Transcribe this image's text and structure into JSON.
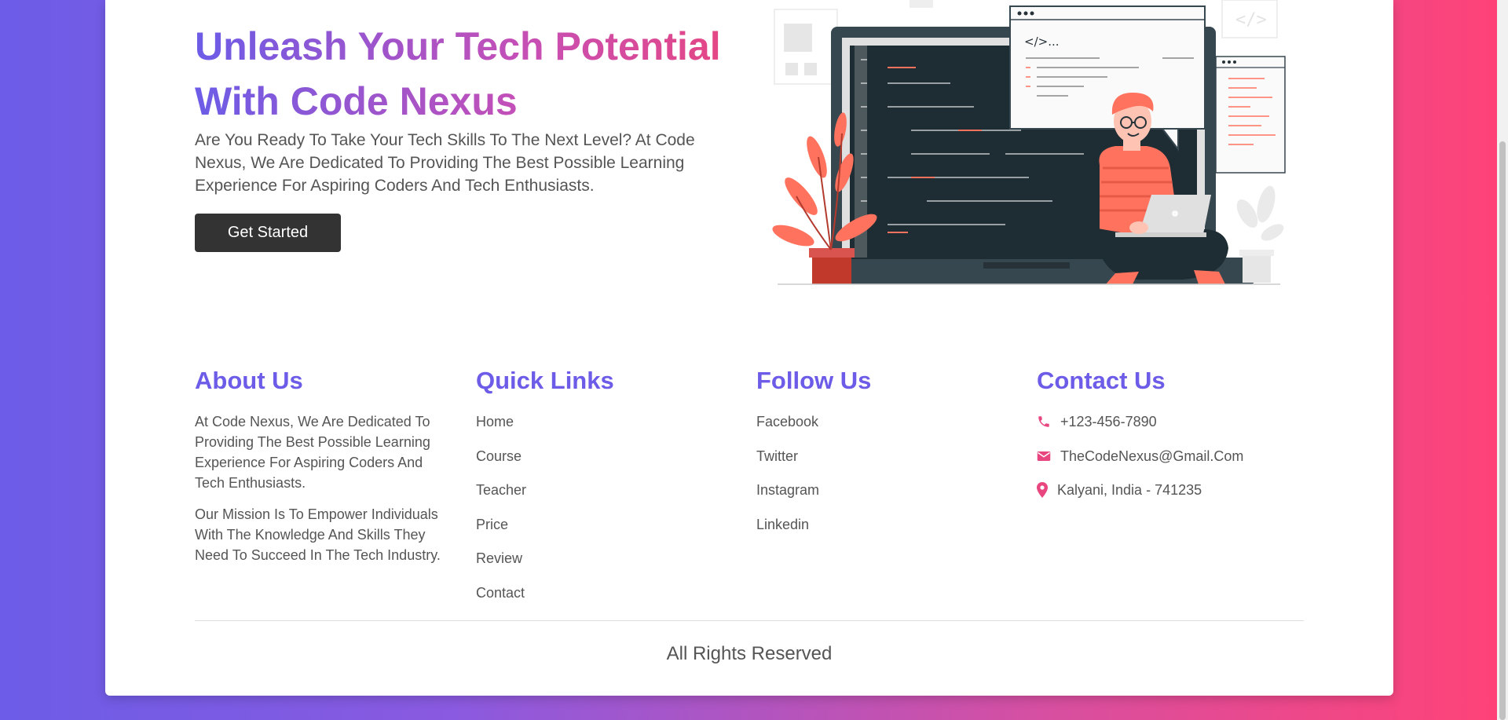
{
  "hero": {
    "title": "Unleash Your Tech Potential With Code Nexus",
    "description": "Are You Ready To Take Your Tech Skills To The Next Level? At Code Nexus, We Are Dedicated To Providing The Best Possible Learning Experience For Aspiring Coders And Tech Enthusiasts.",
    "cta_label": "Get Started",
    "illustration_code_label": "</>...",
    "illustration_icon": "developer-laptop-illustration"
  },
  "footer": {
    "about": {
      "heading": "About Us",
      "paragraphs": [
        "At Code Nexus, We Are Dedicated To Providing The Best Possible Learning Experience For Aspiring Coders And Tech Enthusiasts.",
        "Our Mission Is To Empower Individuals With The Knowledge And Skills They Need To Succeed In The Tech Industry."
      ]
    },
    "quick_links": {
      "heading": "Quick Links",
      "items": [
        "Home",
        "Course",
        "Teacher",
        "Price",
        "Review",
        "Contact"
      ]
    },
    "follow": {
      "heading": "Follow Us",
      "items": [
        "Facebook",
        "Twitter",
        "Instagram",
        "Linkedin"
      ]
    },
    "contact": {
      "heading": "Contact Us",
      "items": [
        {
          "icon": "phone-icon",
          "text": "+123-456-7890"
        },
        {
          "icon": "envelope-icon",
          "text": "TheCodeNexus@Gmail.Com"
        },
        {
          "icon": "map-pin-icon",
          "text": "Kalyani, India - 741235"
        }
      ]
    },
    "copyright": "All Rights Reserved"
  },
  "colors": {
    "accent": "#6c5ce7",
    "pink": "#e8467f",
    "button": "#333333",
    "text": "#555555"
  }
}
